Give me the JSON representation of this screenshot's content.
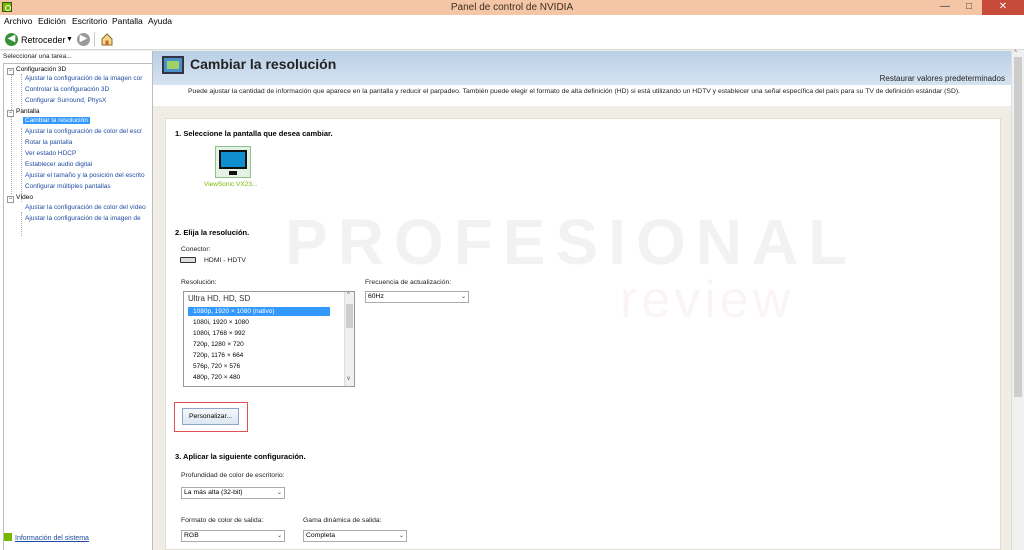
{
  "window": {
    "title": "Panel de control de NVIDIA",
    "minimize": "—",
    "maximize": "□",
    "close": "✕"
  },
  "menu": [
    "Archivo",
    "Edición",
    "Escritorio",
    "Pantalla",
    "Ayuda"
  ],
  "toolbar": {
    "back_label": "Retroceder",
    "back_icon": "back-arrow-icon",
    "forward_icon": "forward-arrow-icon",
    "home_icon": "home-icon"
  },
  "sidebar": {
    "header": "Seleccionar una tarea...",
    "groups": [
      {
        "label": "Configuración 3D",
        "items": [
          "Ajustar la configuración de la imagen cor",
          "Controlar la configuración 3D",
          "Configurar Surround, PhysX"
        ]
      },
      {
        "label": "Pantalla",
        "items": [
          "Cambiar la resolución",
          "Ajustar la configuración de color del escr",
          "Rotar la pantalla",
          "Ver estado HDCP",
          "Establecer audio digital",
          "Ajustar el tamaño y la posición del escrito",
          "Configurar múltiples pantallas"
        ]
      },
      {
        "label": "Vídeo",
        "items": [
          "Ajustar la configuración de color del vídeo",
          "Ajustar la configuración de la imagen de"
        ]
      }
    ],
    "selected_item": "Cambiar la resolución",
    "system_info": "Información del sistema"
  },
  "page": {
    "title": "Cambiar la resolución",
    "restore": "Restaurar valores predeterminados",
    "description": "Puede ajustar la cantidad de información que aparece en la pantalla y reducir el parpadeo. También puede elegir el formato de alta definición (HD) si está utilizando un HDTV y establecer una señal específica del país para su TV de definición estándar (SD).",
    "section1": "1. Seleccione la pantalla que desea cambiar.",
    "display_name": "ViewSonic VX23...",
    "section2": "2. Elija la resolución.",
    "connector_label": "Conector:",
    "connector_value": "HDMI - HDTV",
    "resolution_label": "Resolución:",
    "resolution_group": "Ultra HD, HD, SD",
    "resolutions": [
      "1080p, 1920 × 1080 (nativo)",
      "1080i, 1920 × 1080",
      "1080i, 1768 × 992",
      "720p, 1280 × 720",
      "720p, 1176 × 664",
      "576p, 720 × 576",
      "480p, 720 × 480"
    ],
    "refresh_label": "Frecuencia de actualización:",
    "refresh_value": "60Hz",
    "customize_button": "Personalizar...",
    "section3": "3. Aplicar la siguiente configuración.",
    "color_depth_label": "Profundidad de color de escritorio:",
    "color_depth_value": "La más alta (32-bit)",
    "output_format_label": "Formato de color de salida:",
    "output_format_value": "RGB",
    "dynamic_range_label": "Gama dinámica de salida:",
    "dynamic_range_value": "Completa"
  },
  "watermark": {
    "line1": "PROFESIONAL",
    "line2": "review"
  }
}
